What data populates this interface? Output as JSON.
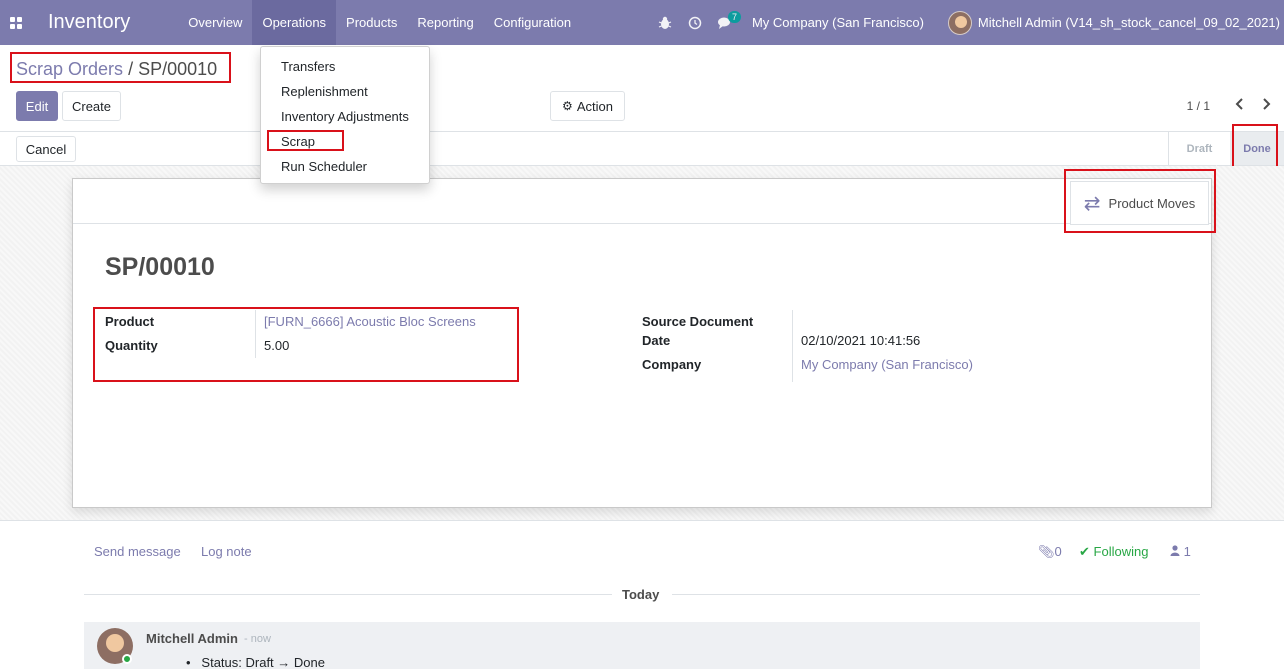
{
  "navbar": {
    "app_name": "Inventory",
    "menu": [
      "Overview",
      "Operations",
      "Products",
      "Reporting",
      "Configuration"
    ],
    "active_menu": "Operations",
    "chat_count": "7",
    "company": "My Company (San Francisco)",
    "user": "Mitchell Admin (V14_sh_stock_cancel_09_02_2021)"
  },
  "dropdown": {
    "items": [
      "Transfers",
      "Replenishment",
      "Inventory Adjustments",
      "Scrap",
      "Run Scheduler"
    ]
  },
  "breadcrumb": {
    "parent": "Scrap Orders",
    "separator": "/",
    "current": "SP/00010"
  },
  "buttons": {
    "edit": "Edit",
    "create": "Create",
    "action": "Action",
    "cancel": "Cancel"
  },
  "pager": {
    "value": "1 / 1"
  },
  "statusbar": {
    "stages": [
      "Draft",
      "Done"
    ],
    "current": "Done"
  },
  "form": {
    "smart_button": "Product Moves",
    "title": "SP/00010",
    "product_label": "Product",
    "product_value": "[FURN_6666] Acoustic Bloc Screens",
    "quantity_label": "Quantity",
    "quantity_value": "5.00",
    "source_label": "Source Document",
    "date_label": "Date",
    "date_value": "02/10/2021 10:41:56",
    "company_label": "Company",
    "company_value": "My Company (San Francisco)"
  },
  "chatter": {
    "send_message": "Send message",
    "log_note": "Log note",
    "attachments": "0",
    "following": "Following",
    "followers": "1",
    "today": "Today",
    "message": {
      "author": "Mitchell Admin",
      "time": "- now",
      "status_label": "Status:",
      "from": "Draft",
      "arrow": "→",
      "to": "Done"
    }
  },
  "colors": {
    "brand": "#7c7bad",
    "highlight": "#d9111a",
    "following": "#28a745"
  }
}
